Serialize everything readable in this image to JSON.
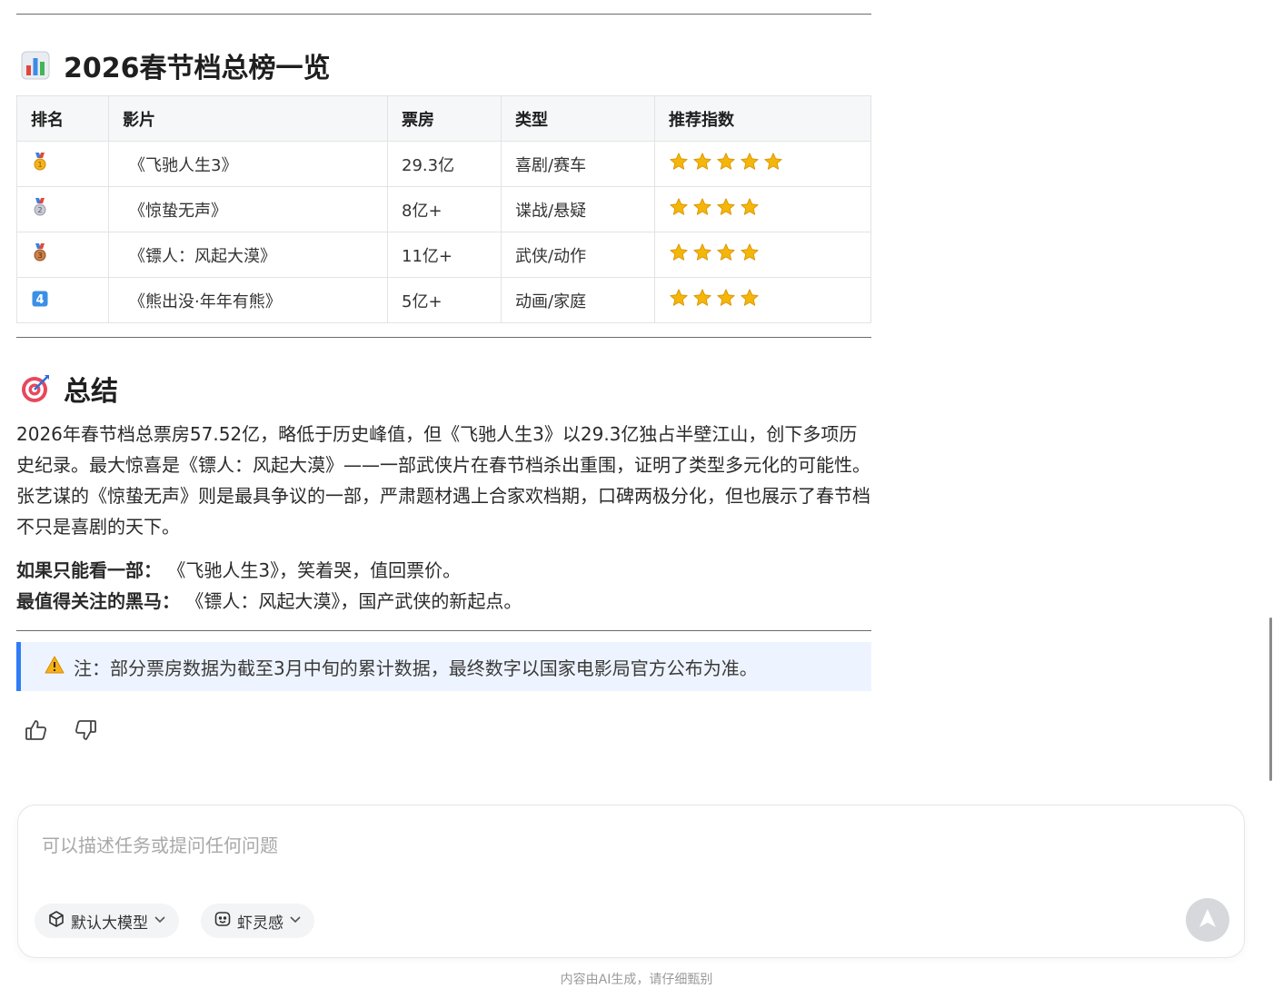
{
  "section1": {
    "title": "2026春节档总榜一览",
    "icon": "bar-chart-icon"
  },
  "table": {
    "headers": [
      "排名",
      "影片",
      "票房",
      "类型",
      "推荐指数"
    ],
    "rows": [
      {
        "rank_icon": "gold-medal-icon",
        "film": "《飞驰人生3》",
        "box_office": "29.3亿",
        "genre": "喜剧/赛车",
        "stars": 5
      },
      {
        "rank_icon": "silver-medal-icon",
        "film": "《惊蛰无声》",
        "box_office": "8亿+",
        "genre": "谍战/悬疑",
        "stars": 4
      },
      {
        "rank_icon": "bronze-medal-icon",
        "film": "《镖人：风起大漠》",
        "box_office": "11亿+",
        "genre": "武侠/动作",
        "stars": 4
      },
      {
        "rank_icon": "keycap-4-icon",
        "film": "《熊出没·年年有熊》",
        "box_office": "5亿+",
        "genre": "动画/家庭",
        "stars": 4
      }
    ]
  },
  "section2": {
    "title": "总结",
    "icon": "target-icon"
  },
  "summary": {
    "paragraph": "2026年春节档总票房57.52亿，略低于历史峰值，但《飞驰人生3》以29.3亿独占半壁江山，创下多项历史纪录。最大惊喜是《镖人：风起大漠》——一部武侠片在春节档杀出重围，证明了类型多元化的可能性。张艺谋的《惊蛰无声》则是最具争议的一部，严肃题材遇上合家欢档期，口碑两极分化，但也展示了春节档不只是喜剧的天下。",
    "line1_label": "如果只能看一部：",
    "line1_text": "《飞驰人生3》，笑着哭，值回票价。",
    "line2_label": "最值得关注的黑马：",
    "line2_text": "《镖人：风起大漠》，国产武侠的新起点。"
  },
  "note": {
    "icon": "warning-icon",
    "text": "注：部分票房数据为截至3月中旬的累计数据，最终数字以国家电影局官方公布为准。"
  },
  "feedback": {
    "like_icon": "thumbs-up-icon",
    "dislike_icon": "thumbs-down-icon"
  },
  "composer": {
    "placeholder": "可以描述任务或提问任何问题",
    "model_label": "默认大模型",
    "mode_label": "虾灵感",
    "send_icon": "send-icon"
  },
  "footer": {
    "text": "内容由AI生成，请仔细甄别"
  },
  "colors": {
    "accent": "#2f7cf6",
    "note_bg": "#eef4ff",
    "star": "#f5b60a"
  }
}
